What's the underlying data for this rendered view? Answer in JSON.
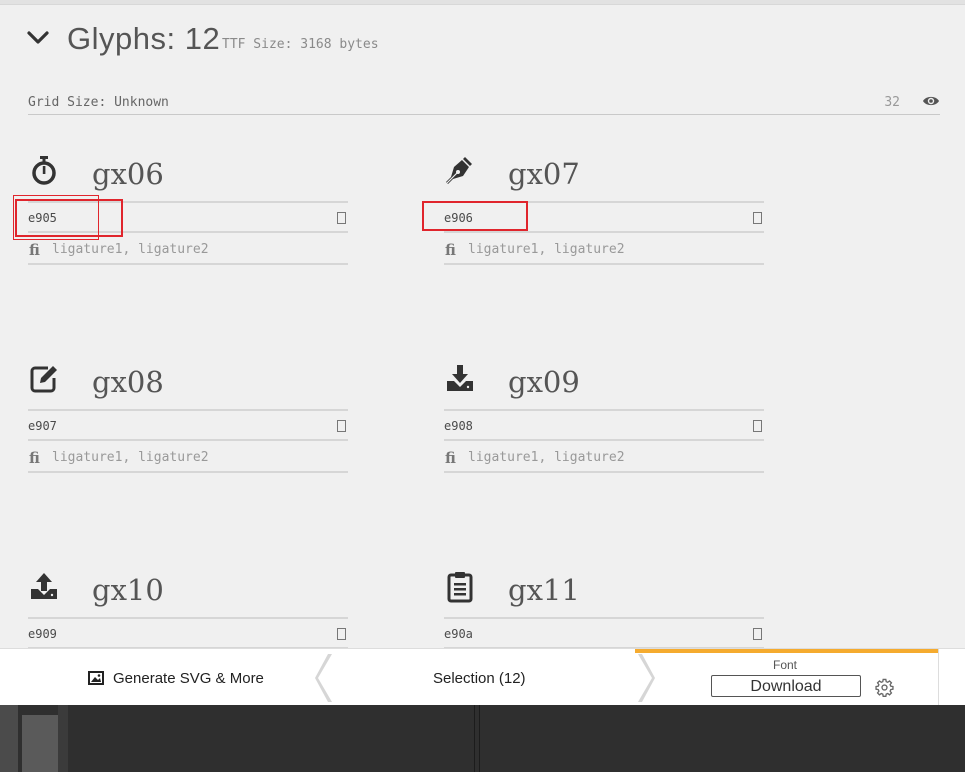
{
  "header": {
    "title": "Glyphs: 12",
    "ttf_size": "TTF Size: 3168 bytes"
  },
  "grid": {
    "label": "Grid Size: Unknown",
    "value": "32"
  },
  "glyphs": [
    {
      "name": "gx06",
      "code": "e905",
      "ligatures": "ligature1, ligature2",
      "icon": "stopwatch-icon"
    },
    {
      "name": "gx07",
      "code": "e906",
      "ligatures": "ligature1, ligature2",
      "icon": "pen-nib-icon"
    },
    {
      "name": "gx08",
      "code": "e907",
      "ligatures": "ligature1, ligature2",
      "icon": "edit-icon"
    },
    {
      "name": "gx09",
      "code": "e908",
      "ligatures": "ligature1, ligature2",
      "icon": "download-tray-icon"
    },
    {
      "name": "gx10",
      "code": "e909",
      "ligatures": "",
      "icon": "upload-tray-icon"
    },
    {
      "name": "gx11",
      "code": "e90a",
      "ligatures": "",
      "icon": "clipboard-icon"
    }
  ],
  "ligature_glyph": "ﬁ",
  "toolbar": {
    "generate_label": "Generate SVG & More",
    "selection_label": "Selection (12)",
    "font_label": "Font",
    "download_label": "Download"
  },
  "colors": {
    "accent": "#f5ab2f",
    "highlight": "#e0252c",
    "background": "#f0f0f0"
  }
}
